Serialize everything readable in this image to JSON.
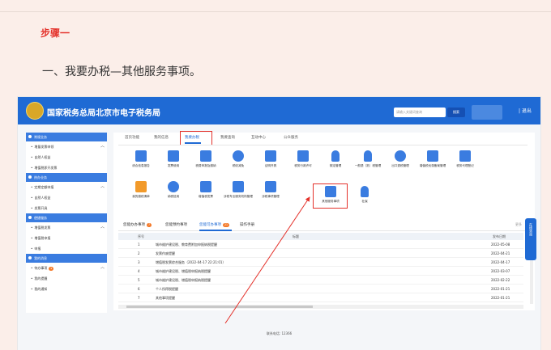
{
  "article": {
    "step_title": "步骤一",
    "instruction": "一、我要办税—其他服务事项。"
  },
  "header": {
    "site_title": "国家税务总局北京市电子税务局",
    "search_placeholder": "请输入关键词查询",
    "search_button": "搜索",
    "exit_label": "| 退出"
  },
  "sidebar": {
    "groups": [
      {
        "title": "常规业务",
        "items": [
          "增量发票申领",
          "自然人权益",
          "增值税即开发票"
        ]
      },
      {
        "title": "热办业务",
        "items": [
          "定期定额申报",
          "自然人权益",
          "发票开具"
        ]
      },
      {
        "title": "便捷服务",
        "items": [
          "增值税发票",
          "增值税申报",
          "申报"
        ]
      },
      {
        "title": "我的消息",
        "items": [
          "待办事项",
          "我的提醒",
          "我的通知"
        ]
      }
    ],
    "badge": "9"
  },
  "tabs": [
    {
      "label": "首页功能"
    },
    {
      "label": "我的信息"
    },
    {
      "label": "我要办税"
    },
    {
      "label": "我要查询"
    },
    {
      "label": "互动中心"
    },
    {
      "label": "公众服务"
    }
  ],
  "icons": [
    {
      "label": "综合信息报告",
      "icon": "doc-icon"
    },
    {
      "label": "发票使用",
      "icon": "invoice-icon"
    },
    {
      "label": "税费申报及缴纳",
      "icon": "tax-declare-icon"
    },
    {
      "label": "税收减免",
      "icon": "relief-icon"
    },
    {
      "label": "证明开具",
      "icon": "certificate-icon"
    },
    {
      "label": "税务行政许可",
      "icon": "permit-icon"
    },
    {
      "label": "核定管理",
      "icon": "person-icon"
    },
    {
      "label": "一般退（抵）税管理",
      "icon": "person-icon"
    },
    {
      "label": "出口退税管理",
      "icon": "globe-icon"
    },
    {
      "label": "增值税优惠备案管理",
      "icon": "calendar-icon"
    },
    {
      "label": "税务代理登记",
      "icon": "cert-icon"
    },
    {
      "label": "我的缴税清单",
      "icon": "list-icon"
    },
    {
      "label": "纳税信用",
      "icon": "shield-icon"
    },
    {
      "label": "增值税发票",
      "icon": "stamp-icon"
    },
    {
      "label": "涉税专业服务机构管理",
      "icon": "agency-icon"
    },
    {
      "label": "涉税事项管理",
      "icon": "gavel-icon"
    },
    {
      "label": "其他服务事项",
      "icon": "document-icon"
    },
    {
      "label": "社保",
      "icon": "person-icon"
    }
  ],
  "sub_tabs": [
    {
      "label": "您能办办事项",
      "badge": "7"
    },
    {
      "label": "您能预约事项",
      "badge": ""
    },
    {
      "label": "您能可办事项",
      "badge": "21"
    },
    {
      "label": "操作手册",
      "badge": ""
    }
  ],
  "more_label": "更多",
  "table": {
    "headers": [
      "序号",
      "标题",
      "发布日期"
    ],
    "rows": [
      {
        "no": "1",
        "title": "城市维护建设税、教育费附加申报纳税提醒",
        "date": "2022-05-08"
      },
      {
        "no": "2",
        "title": "发票作废提醒",
        "date": "2022-04-21"
      },
      {
        "no": "3",
        "title": "增值税发票综合服务（2022-04-17 22:21:01）",
        "date": "2022-04-17"
      },
      {
        "no": "4",
        "title": "城市维护建设税、增值税申报纳税提醒",
        "date": "2022-03-07"
      },
      {
        "no": "5",
        "title": "城市维护建设税、增值税申报纳税提醒",
        "date": "2022-02-22"
      },
      {
        "no": "6",
        "title": "个人所得税提醒",
        "date": "2022-01-21"
      },
      {
        "no": "7",
        "title": "其他事项提醒",
        "date": "2022-01-21"
      }
    ]
  },
  "float_button": "在线咨询",
  "footer": "联系电话: 12366",
  "colors": {
    "accent": "#1f6ad4",
    "highlight": "#e4322b",
    "step": "#e4322b"
  }
}
